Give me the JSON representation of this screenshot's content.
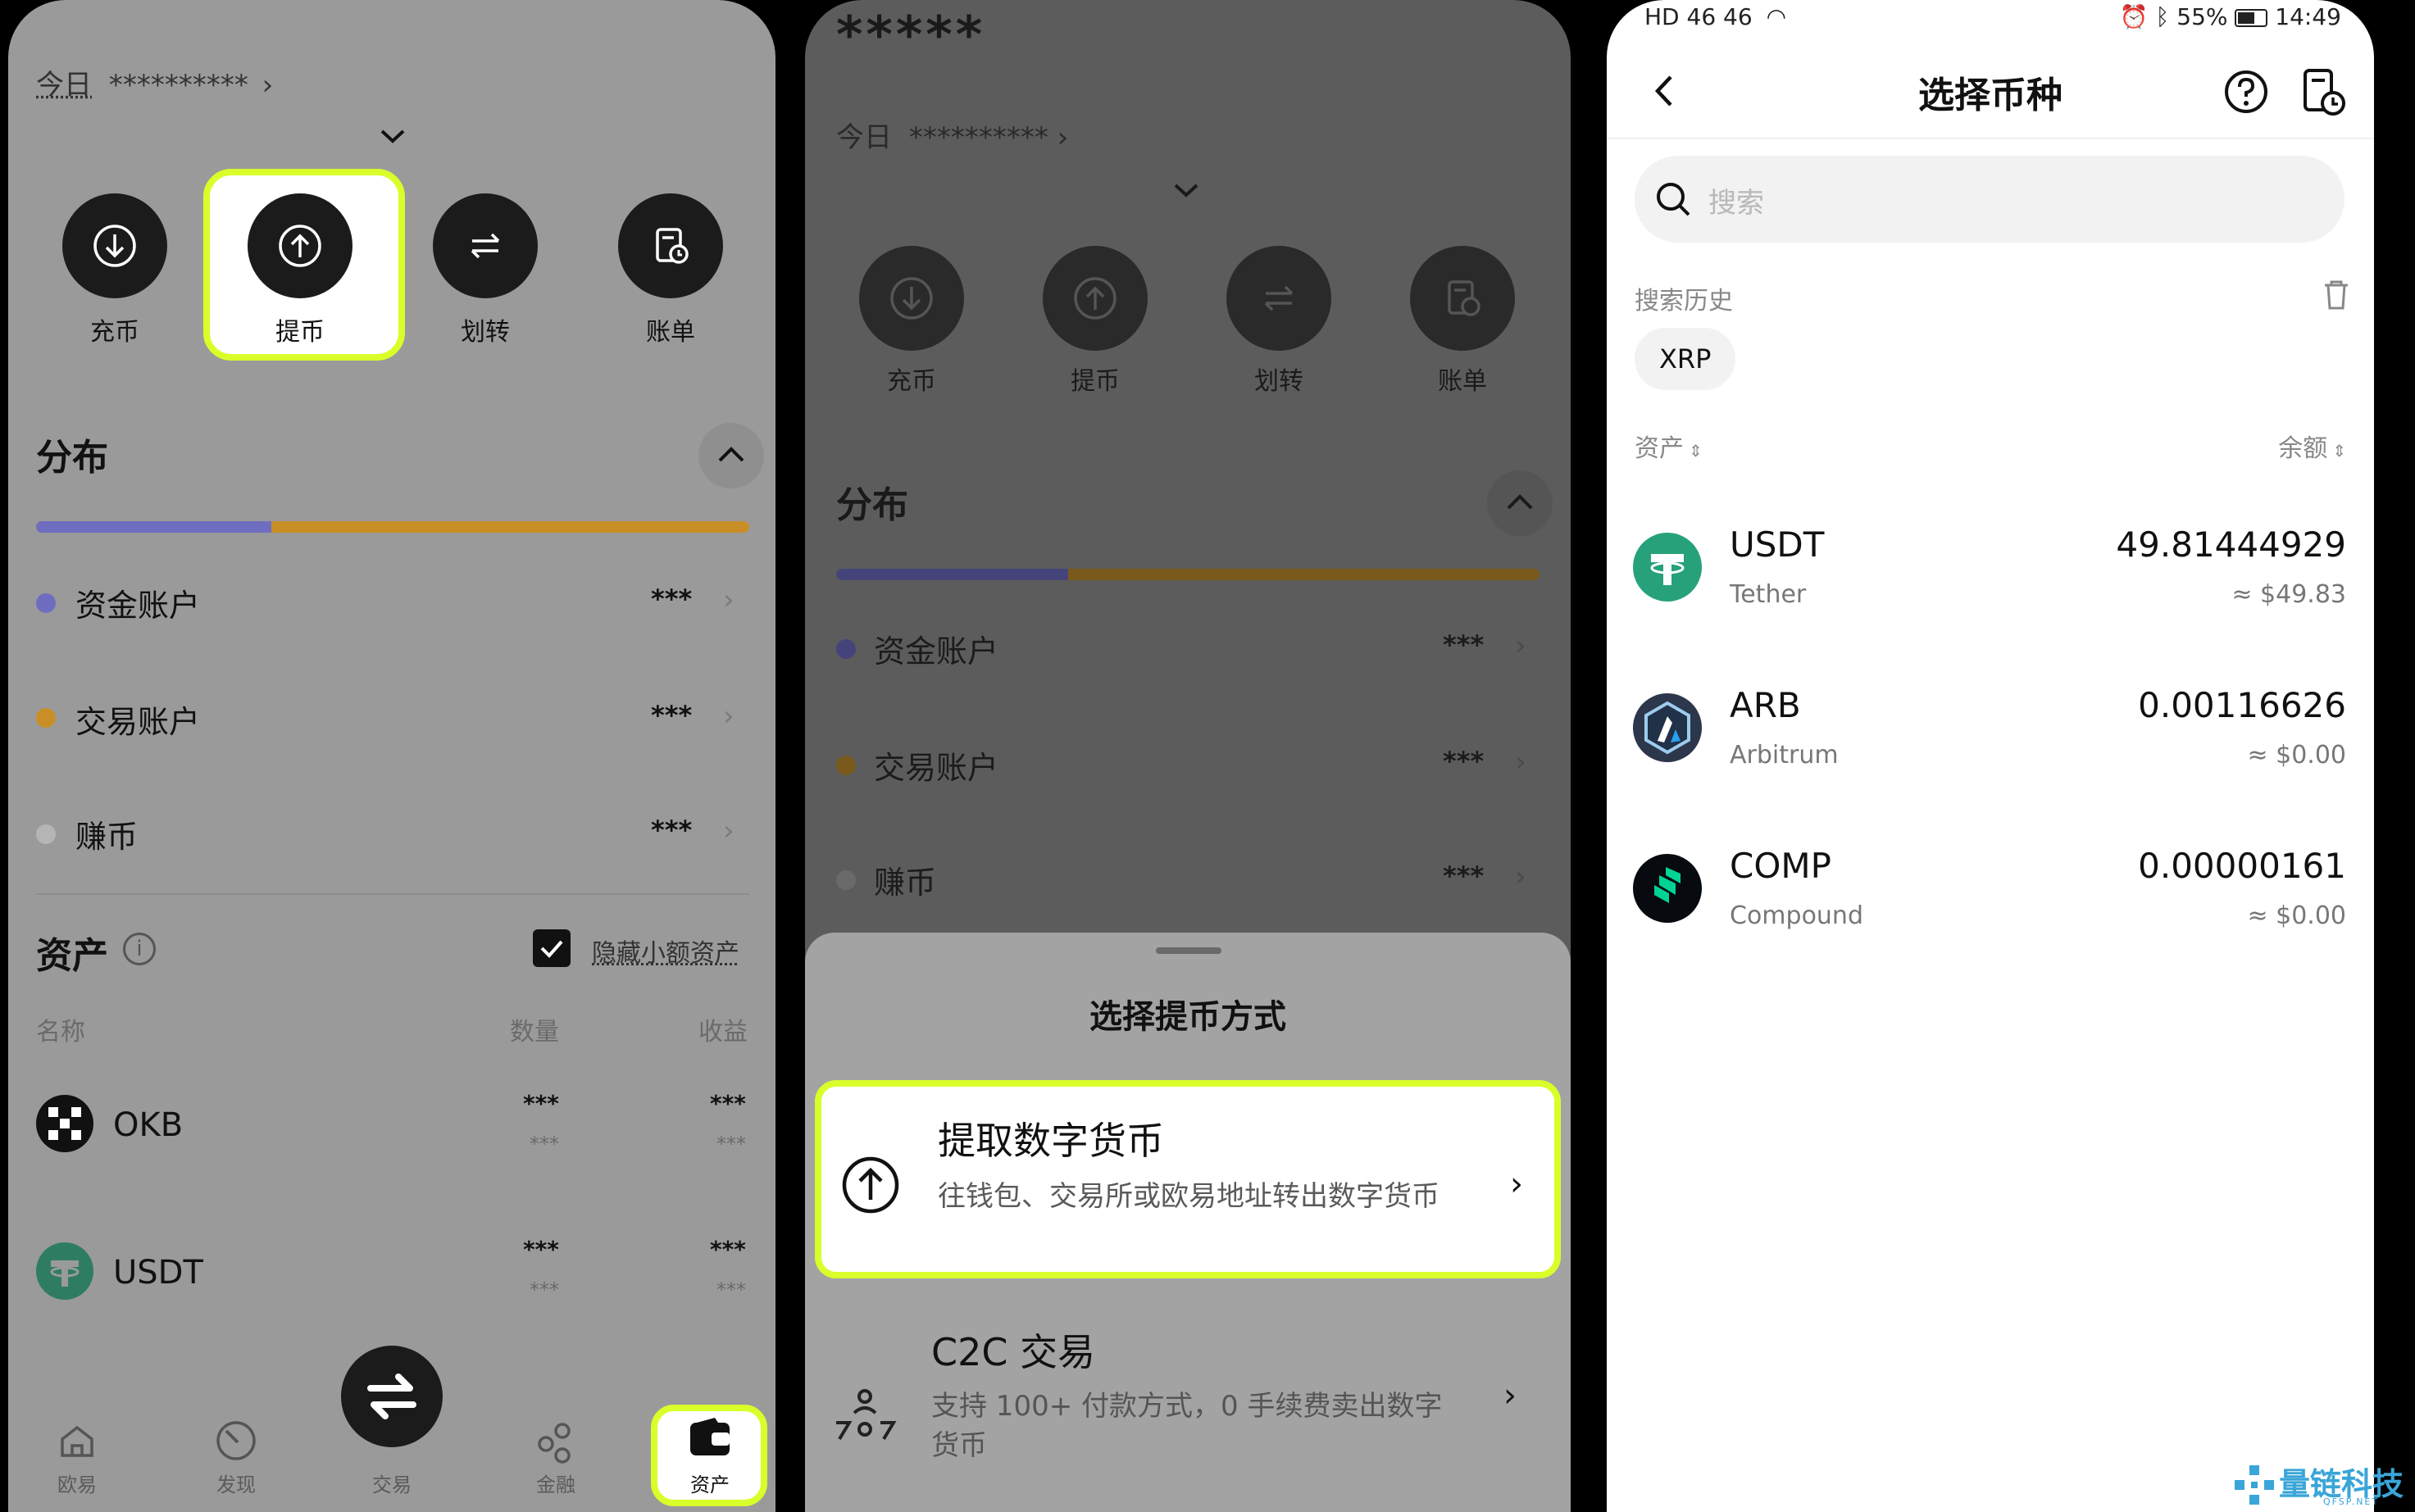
{
  "panel1": {
    "today_label": "今日",
    "today_value": "**********",
    "actions": [
      {
        "label": "充币",
        "icon": "deposit-icon"
      },
      {
        "label": "提币",
        "icon": "withdraw-icon"
      },
      {
        "label": "划转",
        "icon": "transfer-icon"
      },
      {
        "label": "账单",
        "icon": "bill-icon"
      }
    ],
    "distribution_title": "分布",
    "distribution": {
      "fund_fraction": 0.33,
      "colors": {
        "fund": "#6f6dc0",
        "trade": "#c98f26",
        "earn": "#b5b5b5"
      }
    },
    "accounts": [
      {
        "name": "资金账户",
        "value": "***"
      },
      {
        "name": "交易账户",
        "value": "***"
      },
      {
        "name": "赚币",
        "value": "***"
      }
    ],
    "assets_title": "资产",
    "hide_small_label": "隐藏小额资产",
    "columns": {
      "name": "名称",
      "qty": "数量",
      "profit": "收益"
    },
    "coins": [
      {
        "name": "OKB",
        "qty": "***",
        "qty_sub": "***",
        "profit": "***",
        "profit_sub": "***"
      },
      {
        "name": "USDT",
        "qty": "***",
        "qty_sub": "***",
        "profit": "***",
        "profit_sub": "***"
      }
    ],
    "nav": [
      {
        "label": "欧易",
        "icon": "home-icon"
      },
      {
        "label": "发现",
        "icon": "discover-icon"
      },
      {
        "label": "交易",
        "icon": "trade-icon"
      },
      {
        "label": "金融",
        "icon": "finance-icon"
      },
      {
        "label": "资产",
        "icon": "wallet-icon"
      }
    ]
  },
  "panel2": {
    "masked_total": "*****",
    "today_label": "今日",
    "today_value": "**********",
    "actions": [
      {
        "label": "充币"
      },
      {
        "label": "提币"
      },
      {
        "label": "划转"
      },
      {
        "label": "账单"
      }
    ],
    "distribution_title": "分布",
    "accounts": [
      {
        "name": "资金账户",
        "value": "***"
      },
      {
        "name": "交易账户",
        "value": "***"
      },
      {
        "name": "赚币",
        "value": "***"
      }
    ],
    "sheet_title": "选择提币方式",
    "options": [
      {
        "title": "提取数字货币",
        "desc": "往钱包、交易所或欧易地址转出数字货币"
      },
      {
        "title": "C2C 交易",
        "desc": "支持 100+ 付款方式，0 手续费卖出数字货币"
      }
    ]
  },
  "panel3": {
    "status": {
      "left": "HD 46 46",
      "battery": "55%",
      "time": "14:49"
    },
    "title": "选择币种",
    "search_placeholder": "搜索",
    "history_label": "搜索历史",
    "history_chips": [
      "XRP"
    ],
    "col_asset": "资产",
    "col_balance": "余额",
    "coins": [
      {
        "symbol": "USDT",
        "name": "Tether",
        "amount": "49.81444929",
        "usd": "≈ $49.83",
        "color": "#26a17b"
      },
      {
        "symbol": "ARB",
        "name": "Arbitrum",
        "amount": "0.00116626",
        "usd": "≈ $0.00",
        "color": "#2d374b"
      },
      {
        "symbol": "COMP",
        "name": "Compound",
        "amount": "0.00000161",
        "usd": "≈ $0.00",
        "color": "#070a0e"
      }
    ]
  },
  "watermark": {
    "main": "量链科技",
    "sub": "QFSP.NET"
  }
}
